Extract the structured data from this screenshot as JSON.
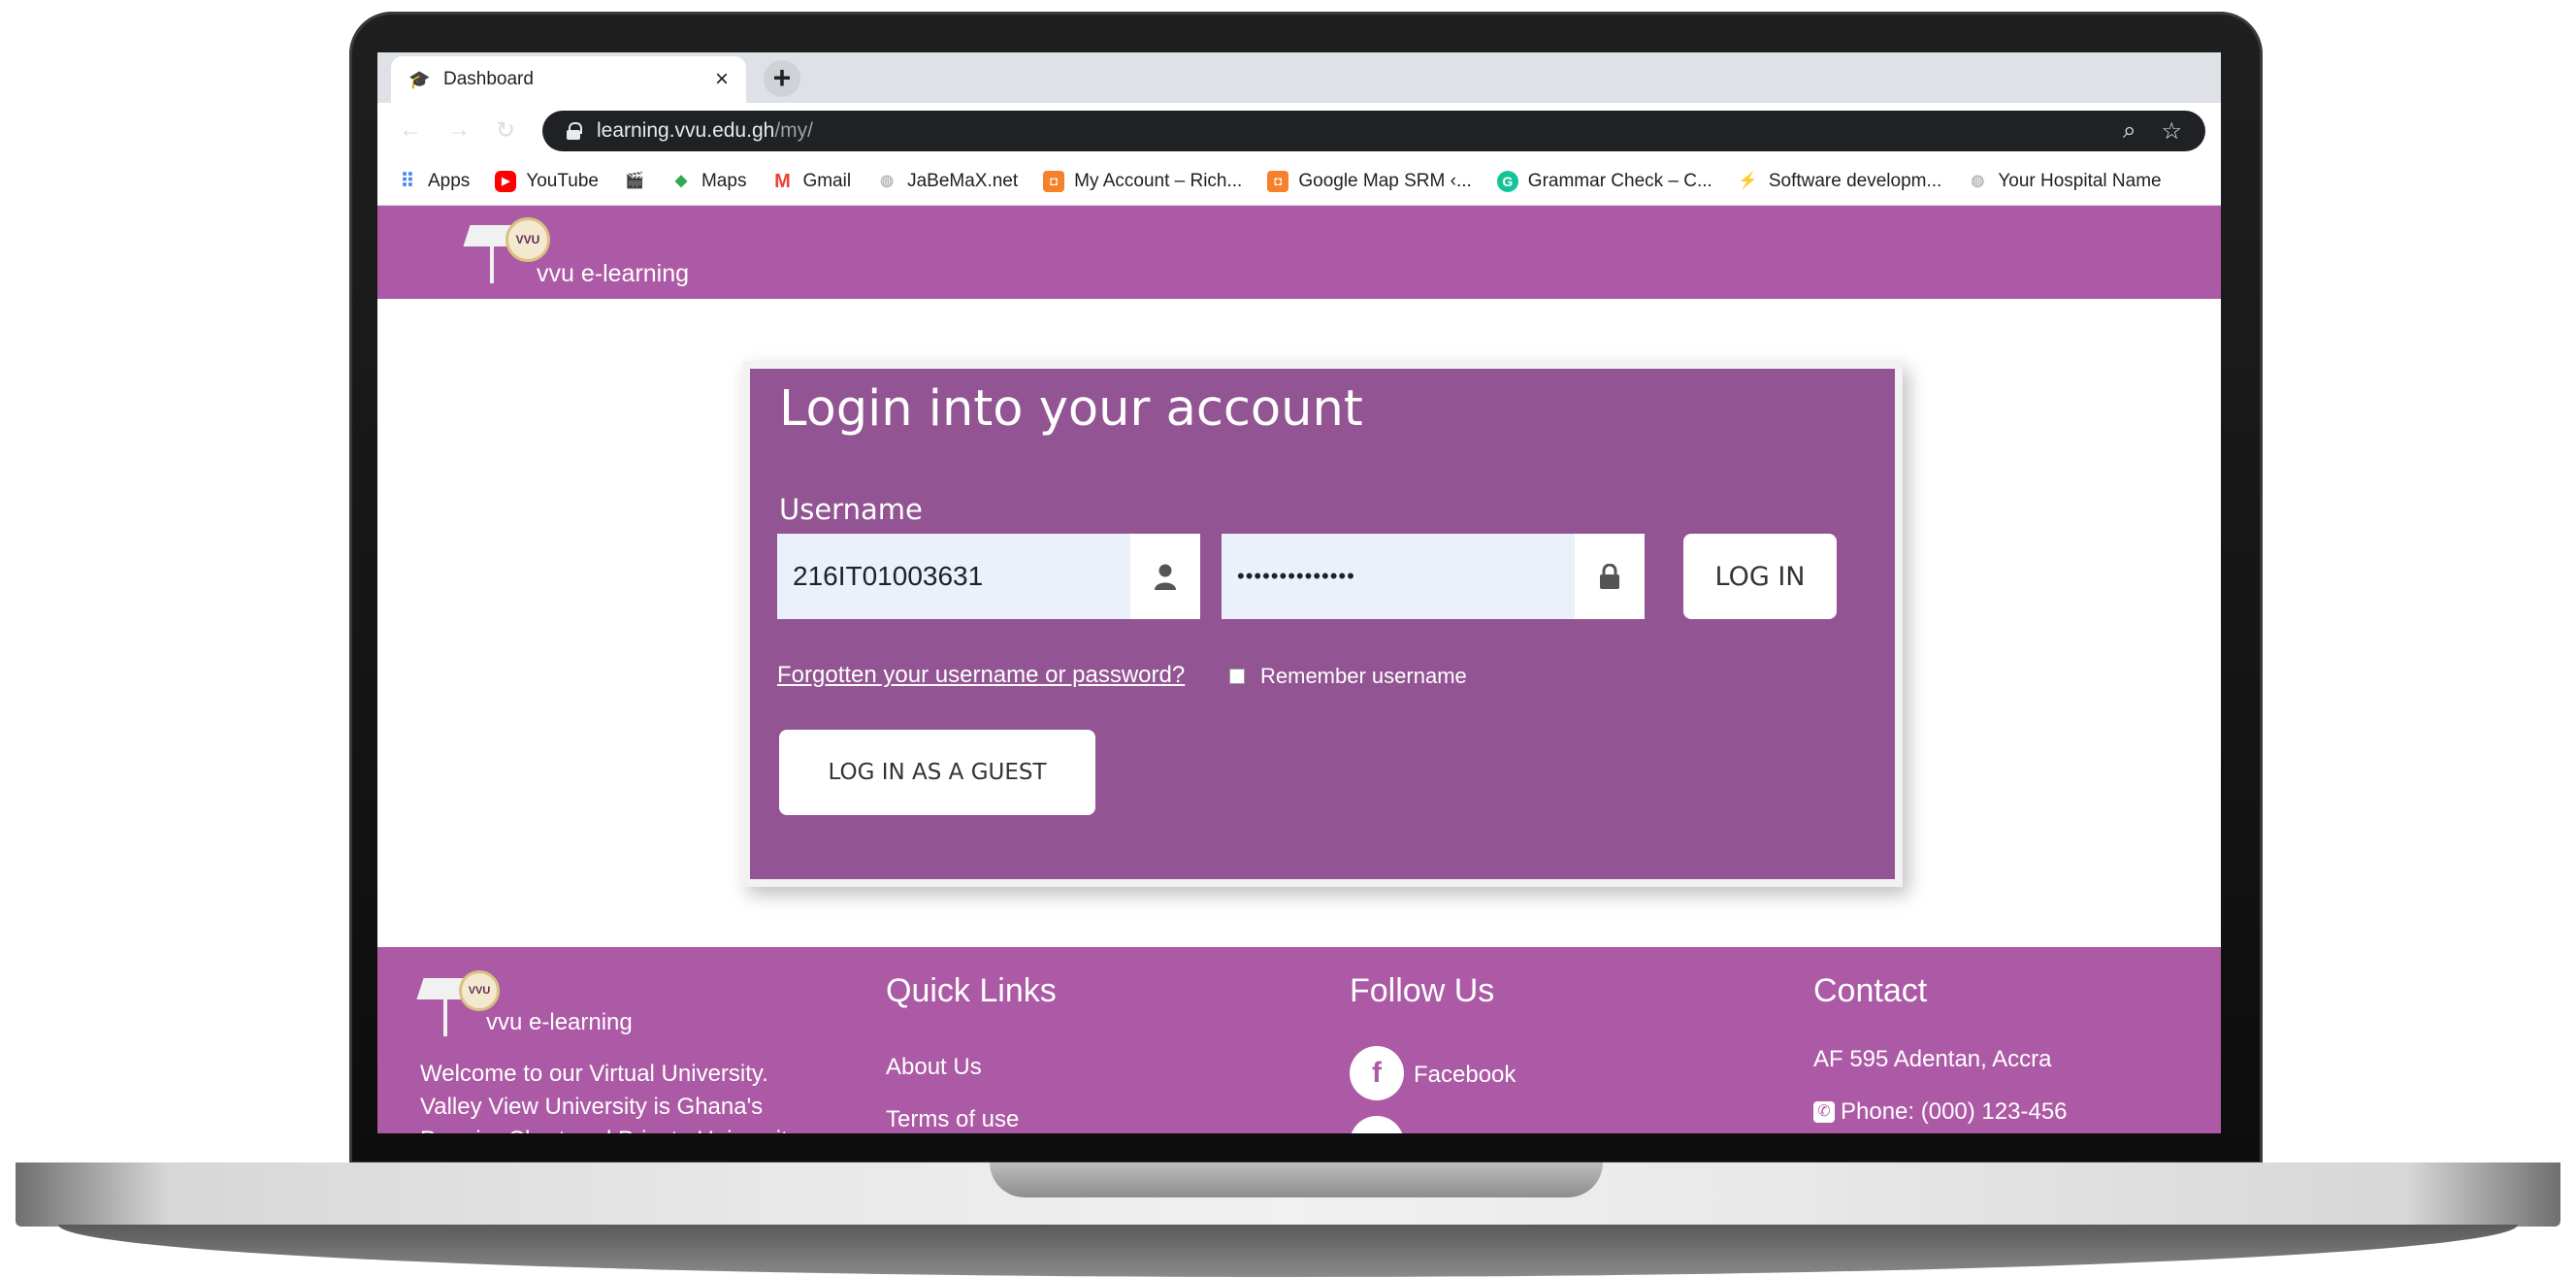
{
  "browser": {
    "tab": {
      "title": "Dashboard",
      "close_glyph": "×"
    },
    "newtab_glyph": "+",
    "url": {
      "host": "learning.vvu.edu.gh",
      "path": "/my/"
    },
    "bookmarks": [
      {
        "label": "Apps",
        "icon": "apps-grid-icon"
      },
      {
        "label": "YouTube",
        "icon": "youtube-icon"
      },
      {
        "label": "",
        "icon": "clapper-icon"
      },
      {
        "label": "Maps",
        "icon": "maps-icon"
      },
      {
        "label": "Gmail",
        "icon": "gmail-icon"
      },
      {
        "label": "JaBeMaX.net",
        "icon": "globe-icon"
      },
      {
        "label": "My Account – Rich...",
        "icon": "orange-site-icon"
      },
      {
        "label": "Google Map SRM ‹...",
        "icon": "orange-site-icon"
      },
      {
        "label": "Grammar Check – C...",
        "icon": "grammarly-icon"
      },
      {
        "label": "Software developm...",
        "icon": "bolt-icon"
      },
      {
        "label": "Your Hospital Name",
        "icon": "globe-icon"
      }
    ]
  },
  "site": {
    "logo_seal": "VVU",
    "logo_text": "vvu e-learning"
  },
  "login": {
    "title": "Login into your account",
    "username_label": "Username",
    "username_value": "216IT01003631",
    "password_value": "••••••••••••••",
    "login_button": "LOG IN",
    "forgot_link": "Forgotten your username or password?",
    "remember_label": "Remember username",
    "guest_button": "LOG IN AS A GUEST"
  },
  "footer": {
    "welcome_text": "Welcome to our Virtual University. Valley View University is Ghana's Premier Chartered Private University",
    "quick_links": {
      "title": "Quick Links",
      "items": [
        "About Us",
        "Terms of use"
      ]
    },
    "follow_us": {
      "title": "Follow Us",
      "facebook": "Facebook"
    },
    "contact": {
      "title": "Contact",
      "address": "AF 595 Adentan, Accra",
      "phone": "Phone: (000) 123-456"
    }
  },
  "colors": {
    "header_purple": "#ad5aa6",
    "card_purple": "#925493",
    "omnibox_dark": "#202124"
  }
}
